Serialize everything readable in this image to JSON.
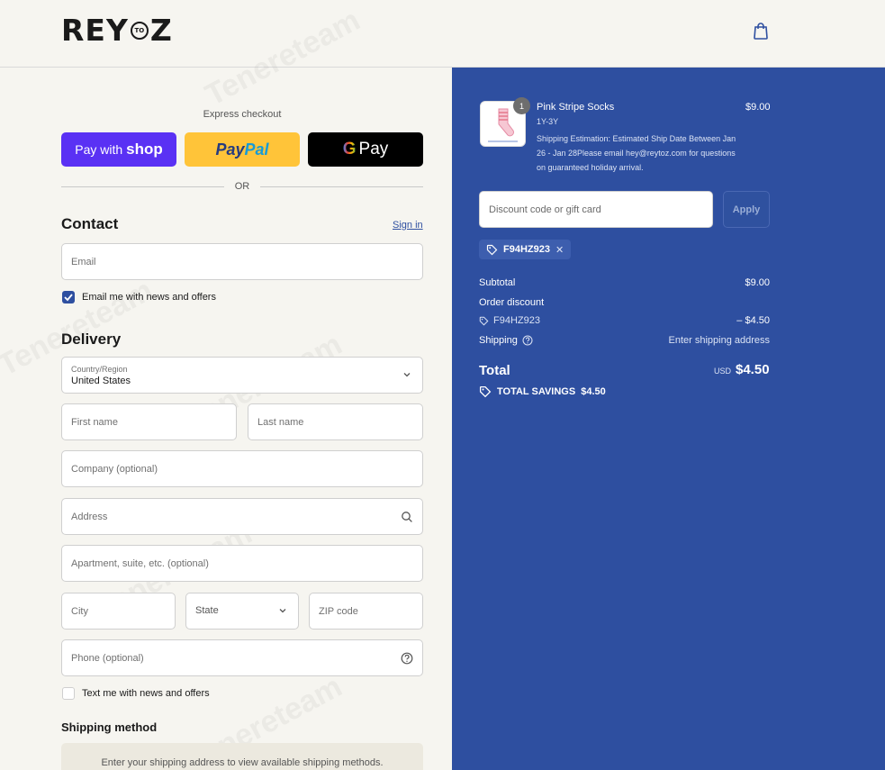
{
  "header": {
    "logo_left": "REY",
    "logo_circle": "TO",
    "logo_right": "Z",
    "cart_icon": "shopping-bag-icon"
  },
  "express": {
    "label": "Express checkout",
    "shop_pay_prefix": "Pay with",
    "shop_pay_brand": "shop",
    "paypal_pay": "Pay",
    "paypal_pal": "Pal",
    "gpay_g": "G",
    "gpay_text": "Pay",
    "or": "OR"
  },
  "contact": {
    "title": "Contact",
    "signin": "Sign in",
    "email_placeholder": "Email",
    "newsletter_label": "Email me with news and offers",
    "newsletter_checked": true
  },
  "delivery": {
    "title": "Delivery",
    "country_label": "Country/Region",
    "country_value": "United States",
    "first_name_placeholder": "First name",
    "last_name_placeholder": "Last name",
    "company_placeholder": "Company (optional)",
    "address_placeholder": "Address",
    "apartment_placeholder": "Apartment, suite, etc. (optional)",
    "city_placeholder": "City",
    "state_label": "State",
    "zip_placeholder": "ZIP code",
    "phone_placeholder": "Phone (optional)",
    "sms_label": "Text me with news and offers",
    "sms_checked": false
  },
  "shipping_method": {
    "title": "Shipping method",
    "notice": "Enter your shipping address to view available shipping methods."
  },
  "summary": {
    "item": {
      "quantity": "1",
      "name": "Pink Stripe Socks",
      "variant": "1Y-3Y",
      "note": "Shipping Estimation: Estimated Ship Date Between Jan 26 - Jan 28Please email hey@reytoz.com for questions on guaranteed holiday arrival.",
      "price": "$9.00"
    },
    "discount_placeholder": "Discount code or gift card",
    "apply_label": "Apply",
    "applied_code": "F94HZ923",
    "subtotal_label": "Subtotal",
    "subtotal_value": "$9.00",
    "order_discount_label": "Order discount",
    "discount_code": "F94HZ923",
    "discount_value": "– $4.50",
    "shipping_label": "Shipping",
    "shipping_value": "Enter shipping address",
    "total_label": "Total",
    "currency": "USD",
    "total_value": "$4.50",
    "savings_label": "TOTAL SAVINGS",
    "savings_value": "$4.50"
  },
  "watermark": "Tenereteam",
  "colors": {
    "accent": "#2e4fa0",
    "shop_pay": "#5a31f4",
    "paypal": "#ffc439",
    "background": "#f6f5f0"
  }
}
